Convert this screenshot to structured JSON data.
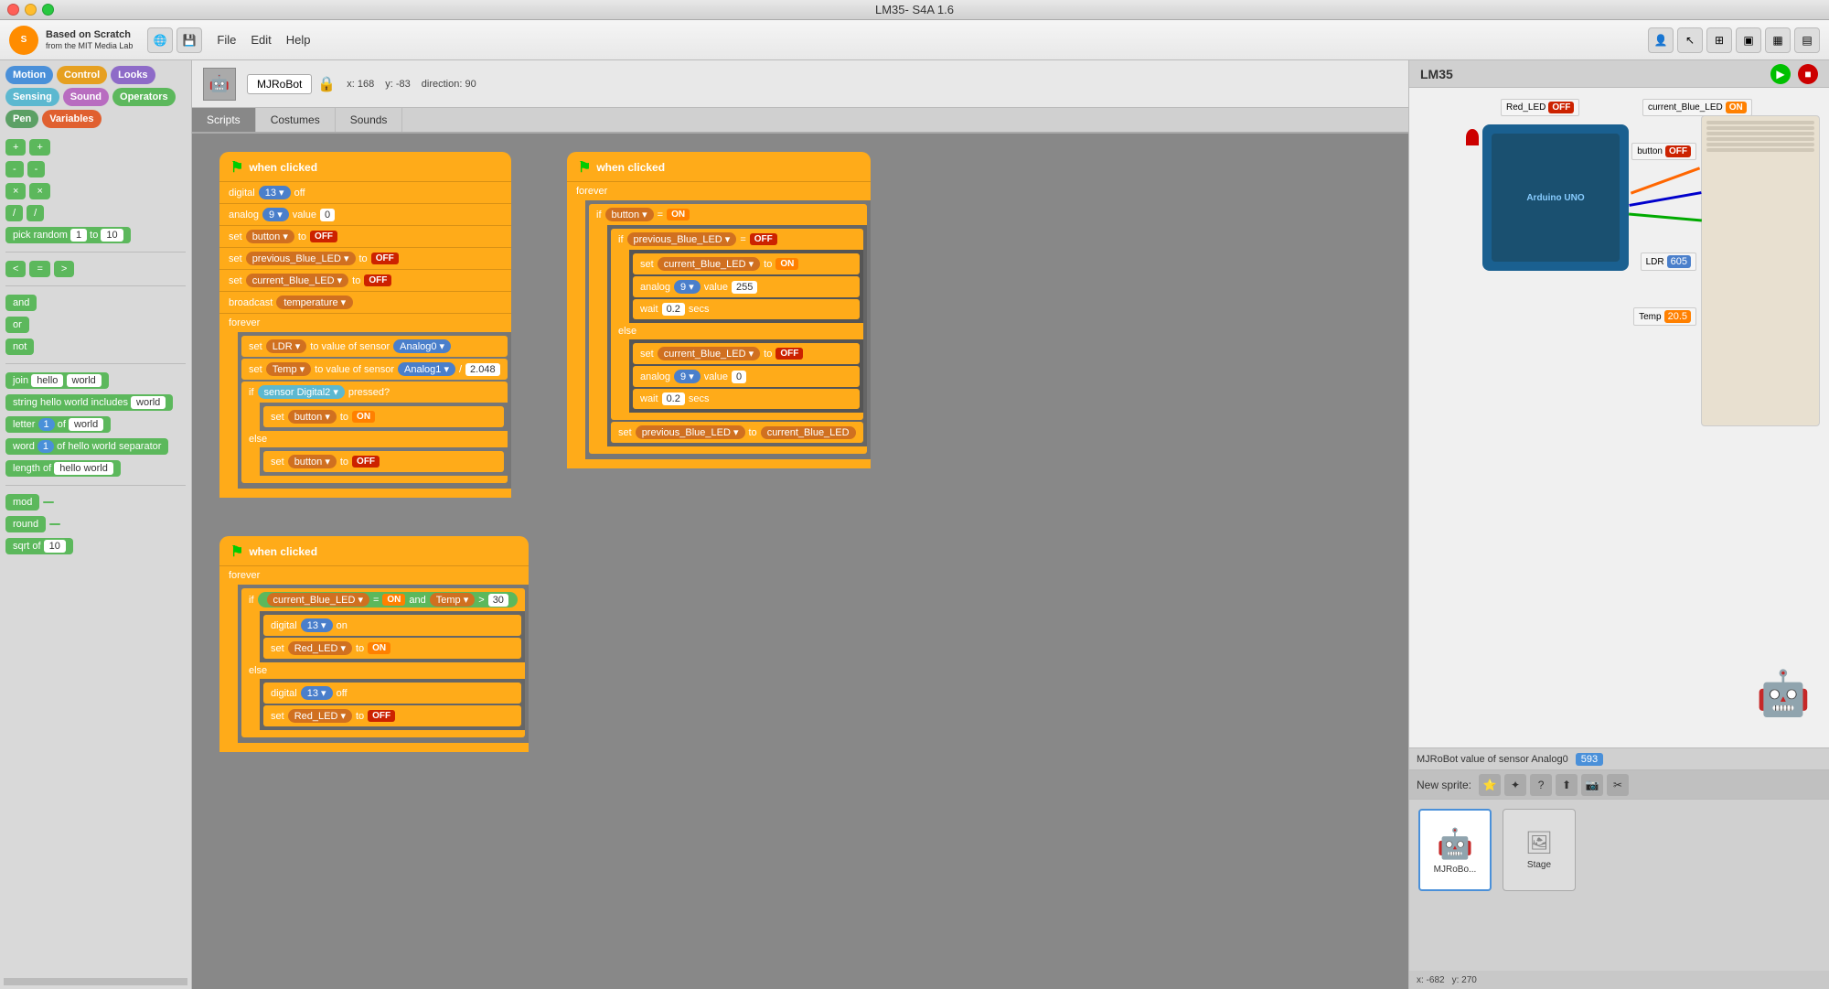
{
  "window": {
    "title": "LM35- S4A 1.6"
  },
  "titlebar": {
    "title": "LM35- S4A 1.6"
  },
  "menubar": {
    "logo": "S",
    "logo_line1": "Based on Scratch",
    "logo_line2": "from the MIT Media Lab",
    "file": "File",
    "edit": "Edit",
    "help": "Help"
  },
  "sprite_header": {
    "name": "MJRoBot",
    "x": "x: 168",
    "y": "y: -83",
    "direction": "direction: 90"
  },
  "tabs": {
    "scripts": "Scripts",
    "costumes": "Costumes",
    "sounds": "Sounds"
  },
  "categories": {
    "motion": "Motion",
    "control": "Control",
    "looks": "Looks",
    "sensing": "Sensing",
    "sound": "Sound",
    "operators": "Operators",
    "pen": "Pen",
    "variables": "Variables"
  },
  "blocks": {
    "pick_random": "pick random",
    "to1": "1",
    "to10": "10",
    "and": "and",
    "or": "or",
    "not": "not",
    "join": "join",
    "hello1": "hello",
    "world1": "world",
    "string_hello_world": "string hello world includes",
    "world2": "world",
    "letter": "letter",
    "of": "of",
    "world_str": "world",
    "word": "word",
    "of2": "of",
    "hello_world": "hello world separator",
    "length": "length of",
    "hello_world2": "hello world",
    "mod": "mod",
    "round": "round",
    "sqrt": "sqrt of",
    "ten": "10"
  },
  "scripts": {
    "script1": {
      "hat": "when clicked",
      "lines": [
        "digital 13 off",
        "analog 9 value 0",
        "set button to OFF",
        "set previous_Blue_LED to OFF",
        "set current_Blue_LED to OFF",
        "broadcast temperature",
        "forever",
        "set LDR to value of sensor Analog0",
        "set Temp to value of sensor Analog1 / 2.048",
        "if sensor Digital2 pressed?",
        "set button to ON",
        "else",
        "set button to OFF"
      ]
    },
    "script2": {
      "hat": "when clicked",
      "lines": [
        "forever",
        "if button = ON",
        "if previous_Blue_LED = OFF",
        "set current_Blue_LED to ON",
        "analog 9 value 255",
        "wait 0.2 secs",
        "else",
        "set current_Blue_LED to OFF",
        "analog 9 value 0",
        "wait 0.2 secs",
        "set previous_Blue_LED to current_Blue_LED"
      ]
    },
    "script3": {
      "hat": "when clicked",
      "lines": [
        "forever",
        "if current_Blue_LED = ON and Temp > 30",
        "digital 13 on",
        "set Red_LED to ON",
        "else",
        "digital 13 off",
        "set Red_LED to OFF"
      ]
    }
  },
  "stage": {
    "title": "LM35",
    "red_led_label": "Red_LED",
    "red_led_status": "OFF",
    "current_blue_led_label": "current_Blue_LED",
    "current_blue_led_status": "ON",
    "button_label": "button",
    "button_status": "OFF",
    "ldr_label": "LDR",
    "ldr_value": "605",
    "temp_label": "Temp",
    "temp_value": "20.5",
    "sensor_readout": "MJRoBot value of sensor Analog0",
    "sensor_value": "593",
    "x_coord": "x: -682",
    "y_coord": "y: 270"
  },
  "sprite_selector": {
    "label": "New sprite:",
    "sprite1_name": "MJRoBo...",
    "stage_name": "Stage"
  }
}
